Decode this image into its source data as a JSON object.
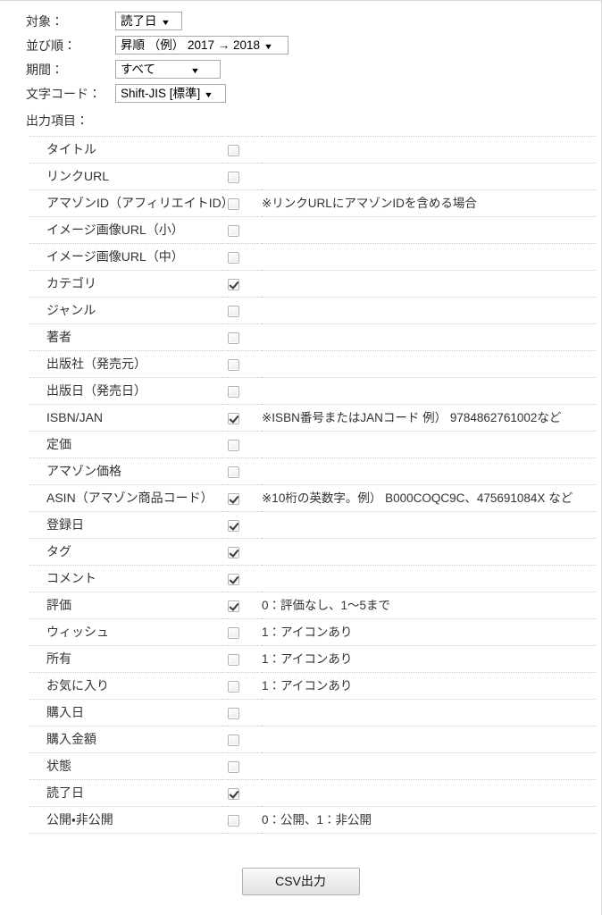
{
  "settings": {
    "rows": [
      {
        "label": "対象：",
        "value": "読了日",
        "width_class": "w-target"
      },
      {
        "label": "並び順：",
        "value": "昇順 （例） 2017 → 2018",
        "width_class": "w-order"
      },
      {
        "label": "期間：",
        "value": "すべて",
        "width_class": "w-period"
      },
      {
        "label": "文字コード：",
        "value": "Shift-JIS [標準]",
        "width_class": "w-charset"
      }
    ],
    "arrow_glyph": "▼"
  },
  "output_items": {
    "section_label": "出力項目：",
    "rows": [
      {
        "name": "タイトル",
        "checked": false,
        "note": ""
      },
      {
        "name": "リンクURL",
        "checked": false,
        "note": ""
      },
      {
        "name": "アマゾンID（アフィリエイトID）",
        "checked": false,
        "note": "※リンクURLにアマゾンIDを含める場合"
      },
      {
        "name": "イメージ画像URL（小）",
        "checked": false,
        "note": ""
      },
      {
        "name": "イメージ画像URL（中）",
        "checked": false,
        "note": ""
      },
      {
        "name": "カテゴリ",
        "checked": true,
        "note": ""
      },
      {
        "name": "ジャンル",
        "checked": false,
        "note": ""
      },
      {
        "name": "著者",
        "checked": false,
        "note": ""
      },
      {
        "name": "出版社（発売元）",
        "checked": false,
        "note": ""
      },
      {
        "name": "出版日（発売日）",
        "checked": false,
        "note": ""
      },
      {
        "name": "ISBN/JAN",
        "checked": true,
        "note": "※ISBN番号またはJANコード 例） 9784862761002など"
      },
      {
        "name": "定価",
        "checked": false,
        "note": ""
      },
      {
        "name": "アマゾン価格",
        "checked": false,
        "note": ""
      },
      {
        "name": "ASIN（アマゾン商品コード）",
        "checked": true,
        "note": "※10桁の英数字。例） B000COQC9C、475691084X など"
      },
      {
        "name": "登録日",
        "checked": true,
        "note": ""
      },
      {
        "name": "タグ",
        "checked": true,
        "note": ""
      },
      {
        "name": "コメント",
        "checked": true,
        "note": ""
      },
      {
        "name": "評価",
        "checked": true,
        "note": "0：評価なし、1〜5まで"
      },
      {
        "name": "ウィッシュ",
        "checked": false,
        "note": "1：アイコンあり"
      },
      {
        "name": "所有",
        "checked": false,
        "note": "1：アイコンあり"
      },
      {
        "name": "お気に入り",
        "checked": false,
        "note": "1：アイコンあり"
      },
      {
        "name": "購入日",
        "checked": false,
        "note": ""
      },
      {
        "name": "購入金額",
        "checked": false,
        "note": ""
      },
      {
        "name": "状態",
        "checked": false,
        "note": ""
      },
      {
        "name": "読了日",
        "checked": true,
        "note": ""
      },
      {
        "name": "公開・非公開",
        "checked": false,
        "note": "0：公開、1：非公開"
      }
    ]
  },
  "submit": {
    "label": "CSV出力"
  }
}
